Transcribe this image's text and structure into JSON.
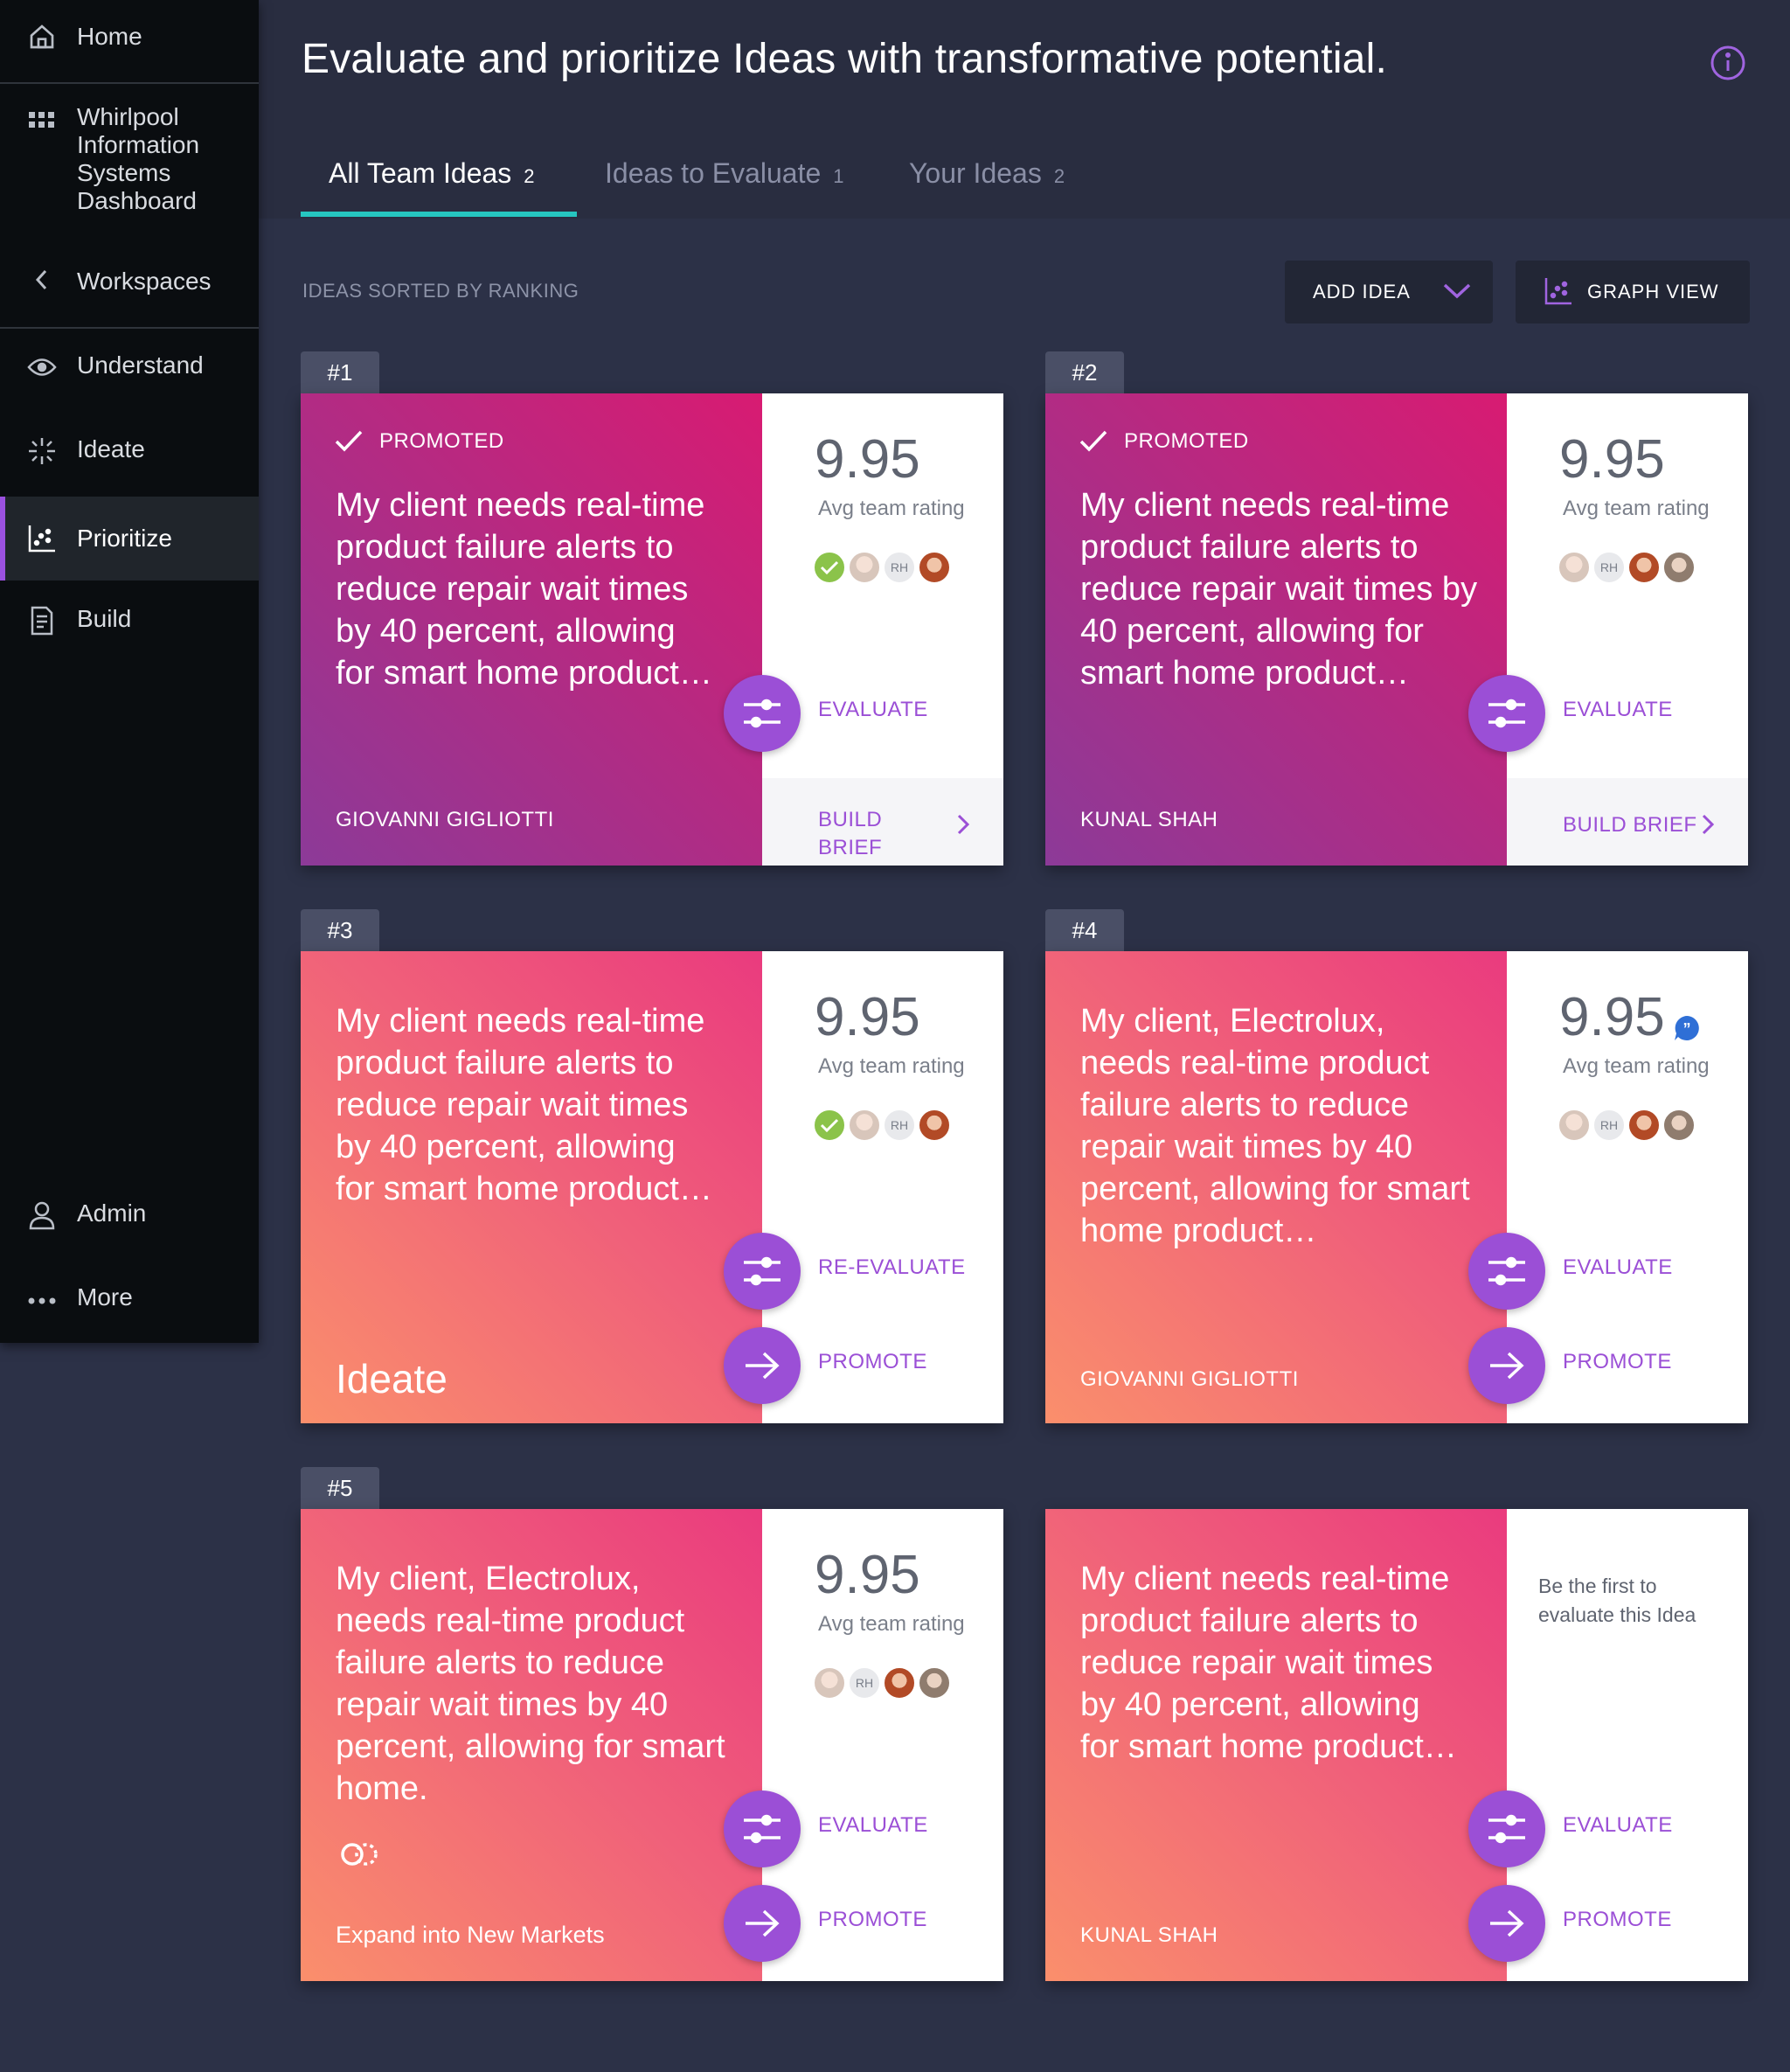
{
  "sidebar": {
    "items": [
      {
        "label": "Home",
        "icon": "home-icon"
      },
      {
        "label": "Whirlpool Information Systems Dashboard",
        "lines": [
          "Whirlpool",
          "Information",
          "Systems",
          "Dashboard"
        ],
        "icon": "grid-icon"
      },
      {
        "label": "Workspaces",
        "icon": "chevron-left-icon"
      },
      {
        "label": "Understand",
        "icon": "eye-icon"
      },
      {
        "label": "Ideate",
        "icon": "sparkle-icon"
      },
      {
        "label": "Prioritize",
        "icon": "scatter-chart-icon",
        "active": true
      },
      {
        "label": "Build",
        "icon": "document-icon"
      },
      {
        "label": "Admin",
        "icon": "user-icon"
      },
      {
        "label": "More",
        "icon": "more-dots-icon"
      }
    ]
  },
  "header": {
    "title": "Evaluate and prioritize Ideas with transformative potential.",
    "info_icon": "info-icon"
  },
  "tabs": [
    {
      "label": "All Team Ideas",
      "count": "2",
      "active": true
    },
    {
      "label": "Ideas to Evaluate",
      "count": "1"
    },
    {
      "label": "Your Ideas",
      "count": "2"
    }
  ],
  "toolbar": {
    "sorted_label": "IDEAS SORTED BY RANKING",
    "add_idea": "ADD IDEA",
    "graph_view": "GRAPH VIEW"
  },
  "colors": {
    "accent": "#9b4fd6",
    "tab_underline": "#26c6c0",
    "sidebar_bg": "#0a0d10",
    "page_bg": "#2c3147"
  },
  "cards": [
    {
      "rank": "#1",
      "promoted_label": "PROMOTED",
      "text": "My client needs real-time product failure alerts to reduce repair wait times by 40 percent, allowing for smart home product…",
      "author": "GIOVANNI GIGLIOTTI",
      "rating": "9.95",
      "rating_label": "Avg team rating",
      "action": "EVALUATE",
      "brief": "BUILD BRIEF"
    },
    {
      "rank": "#2",
      "promoted_label": "PROMOTED",
      "text": "My client needs real-time product failure alerts to reduce repair wait times by 40 percent, allowing for smart home product…",
      "author": "KUNAL SHAH",
      "rating": "9.95",
      "rating_label": "Avg team rating",
      "action": "EVALUATE",
      "brief": "BUILD BRIEF"
    },
    {
      "rank": "#3",
      "text": "My client needs real-time product failure alerts to reduce repair wait times by 40 percent, allowing for smart home product…",
      "stage": "Ideate",
      "rating": "9.95",
      "rating_label": "Avg team rating",
      "action": "RE-EVALUATE",
      "promote": "PROMOTE"
    },
    {
      "rank": "#4",
      "text": "My client, Electrolux, needs real-time product failure alerts to reduce repair wait times by 40 percent, allowing for smart home product…",
      "author": "GIOVANNI GIGLIOTTI",
      "rating": "9.95",
      "rating_label": "Avg team rating",
      "comment_icon": "quote-bubble-icon",
      "action": "EVALUATE",
      "promote": "PROMOTE"
    },
    {
      "rank": "#5",
      "text": "My client, Electrolux, needs real-time product failure alerts to reduce repair wait times by 40 percent, allowing for smart home.",
      "tag": "Expand into New Markets",
      "tag_icon": "venn-circles-icon",
      "rating": "9.95",
      "rating_label": "Avg team rating",
      "action": "EVALUATE",
      "promote": "PROMOTE"
    },
    {
      "text": "My client needs real-time product failure alerts to reduce repair wait times by 40 percent, allowing for smart home product…",
      "author": "KUNAL SHAH",
      "first_eval": "Be the first to evaluate this Idea",
      "action": "EVALUATE",
      "promote": "PROMOTE"
    }
  ]
}
